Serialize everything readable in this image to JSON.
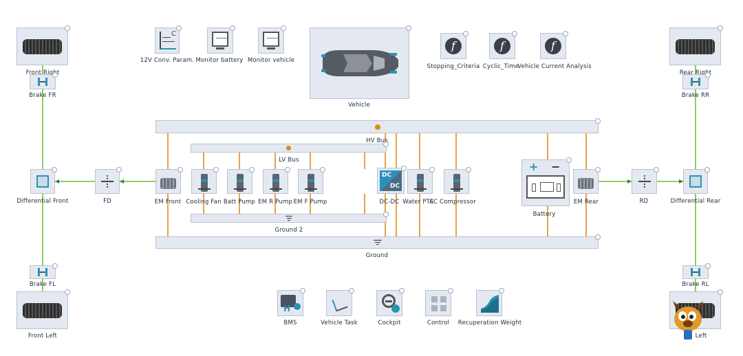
{
  "blocks": {
    "front_right": "Front Right",
    "brake_fr": "Brake FR",
    "differential_front": "Differential Front",
    "fd": "FD",
    "brake_fl": "Brake FL",
    "front_left": "Front Left",
    "conv_params": "12V Conv. Param.",
    "monitor_battery": "Monitor battery",
    "monitor_vehicle": "Monitor vehicle",
    "vehicle": "Vehicle",
    "stopping_criteria": "Stopping_Criteria",
    "cyclic_time": "Cyclic_Time",
    "vehicle_current_analysis": "Vehicle Current Analysis",
    "rear_right": "Rear Right",
    "brake_rr": "Brake RR",
    "differential_rear": "Differential Rear",
    "rd": "RD",
    "brake_rl": "Brake RL",
    "rear_left": "Left",
    "hv_bus": "HV Bus",
    "lv_bus": "LV Bus",
    "em_front": "EM Front",
    "cooling_fan": "Cooling Fan",
    "batt_pump": "Batt Pump",
    "em_r_pump": "EM R Pump",
    "em_f_pump": "EM F Pump",
    "dc_dc": "DC-DC",
    "water_ptc": "Water PTC",
    "ac_compressor": "AC Compressor",
    "battery": "Battery",
    "em_rear": "EM Rear",
    "ground2": "Ground 2",
    "ground": "Ground",
    "bms": "BMS",
    "vehicle_task": "Vehicle Task",
    "cockpit": "Cockpit",
    "control": "Control",
    "recuperation_weight": "Recuperation Weight"
  },
  "icons": {
    "function": "f",
    "dc_top": "DC",
    "dc_bottom": "DC",
    "battery_plus": "+",
    "battery_minus": "−",
    "bms_h": "H"
  },
  "colors": {
    "mechanical_wire": "#6cbf3a",
    "electrical_wire": "#e08a1e",
    "block_fill": "#e4e9f1",
    "accent": "#2a92b5"
  }
}
